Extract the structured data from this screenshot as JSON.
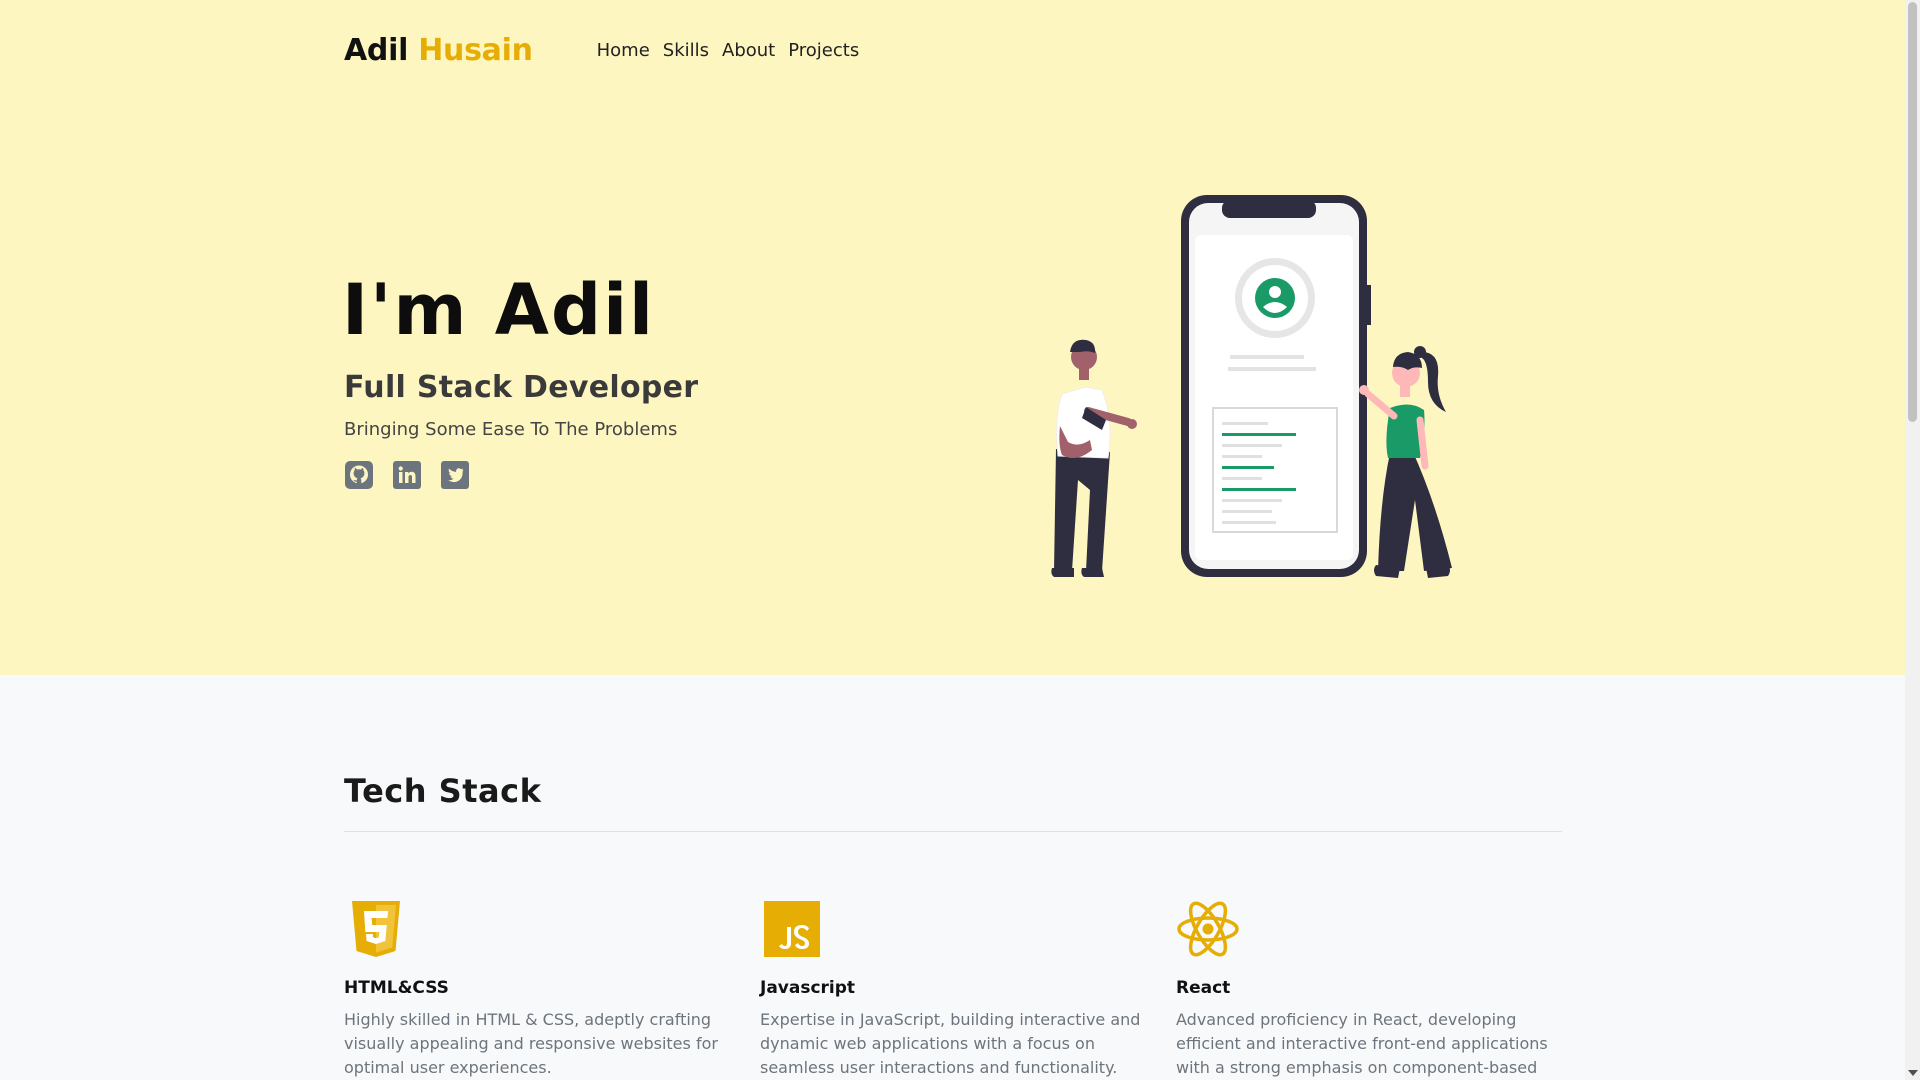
{
  "brand": {
    "first": "Adil",
    "last": "Husain",
    "accent": "#e6ad05"
  },
  "nav": [
    "Home",
    "Skills",
    "About",
    "Projects"
  ],
  "hero": {
    "title": "I'm Adil",
    "subtitle": "Full Stack Developer",
    "tagline": "Bringing Some Ease To The Problems",
    "background": "#fef6c0",
    "socials": [
      "github-icon",
      "linkedin-icon",
      "twitter-icon"
    ]
  },
  "illustration": {
    "icon": "phone-profile-illustration",
    "accent": "#1a9a66"
  },
  "tech": {
    "title": "Tech Stack",
    "items": [
      {
        "icon": "html5-icon",
        "title": "HTML&CSS",
        "text": "Highly skilled in HTML & CSS, adeptly crafting visually appealing and responsive websites for optimal user experiences."
      },
      {
        "icon": "javascript-icon",
        "title": "Javascript",
        "text": "Expertise in JavaScript, building interactive and dynamic web applications with a focus on seamless user interactions and functionality."
      },
      {
        "icon": "react-icon",
        "title": "React",
        "text": "Advanced proficiency in React, developing efficient and interactive front-end applications with a strong emphasis on component-based architecture."
      }
    ]
  }
}
